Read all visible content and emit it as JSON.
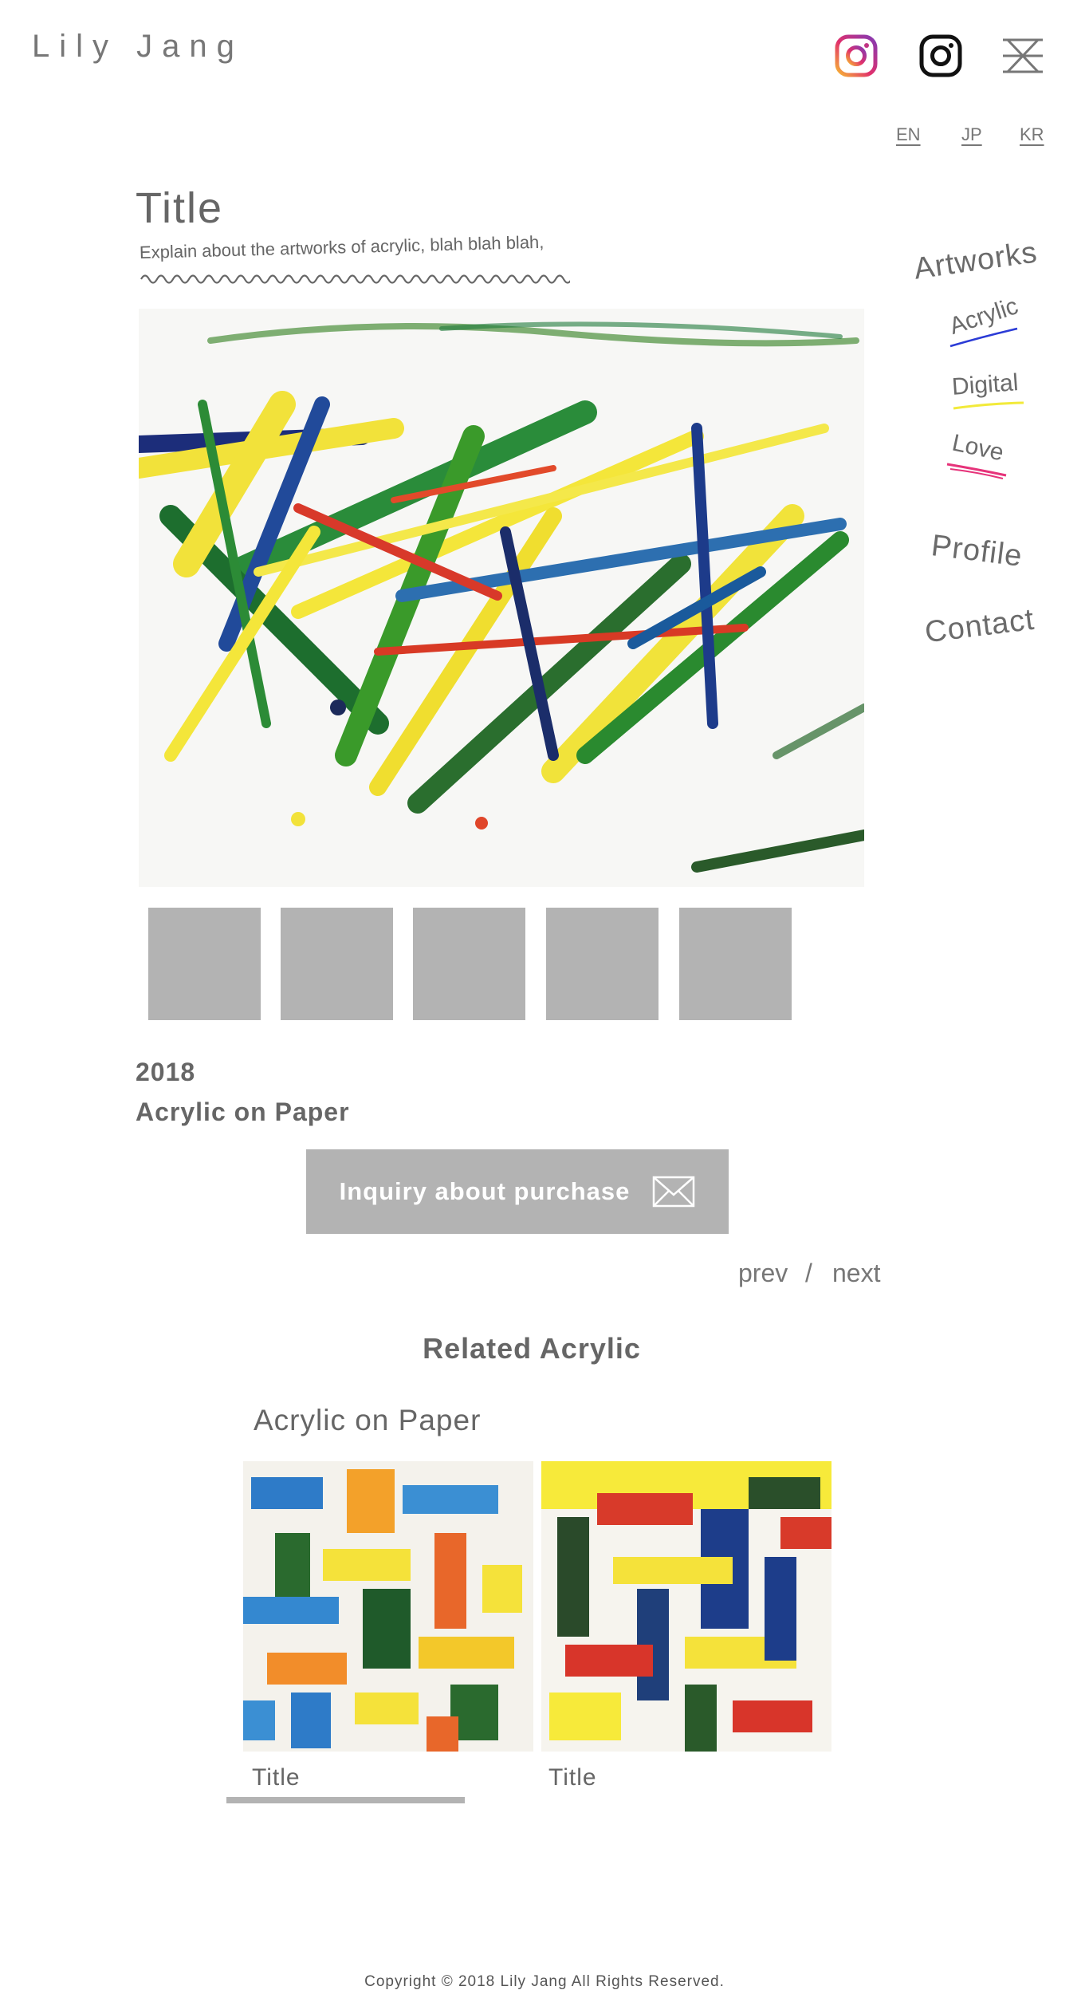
{
  "header": {
    "logo": "Lily Jang",
    "icons": [
      "instagram-color-icon",
      "instagram-icon",
      "close-icon"
    ]
  },
  "languages": [
    "EN",
    "JP",
    "KR"
  ],
  "artwork": {
    "title": "Title",
    "description": "Explain about the artworks of acrylic, blah blah blah,",
    "year": "2018",
    "medium": "Acrylic on Paper"
  },
  "inquiry": {
    "label": "Inquiry about purchase",
    "icon": "envelope-icon"
  },
  "pager": {
    "prev": "prev",
    "separator": "/",
    "next": "next"
  },
  "related": {
    "heading": "Related Acrylic",
    "subheading": "Acrylic on Paper",
    "items": [
      {
        "label": "Title"
      },
      {
        "label": "Title"
      }
    ]
  },
  "sidebar": {
    "artworks": "Artworks",
    "categories": [
      {
        "label": "Acrylic",
        "color": "#2b3bd6"
      },
      {
        "label": "Digital",
        "color": "#f2ea3a"
      },
      {
        "label": "Love",
        "color": "#e6337a"
      }
    ],
    "profile": "Profile",
    "contact": "Contact"
  },
  "colors": {
    "accent_gray": "#b3b3b3",
    "text": "#6b6b6b"
  },
  "footer": {
    "copyright": "Copyright © 2018 Lily Jang All Rights Reserved."
  }
}
